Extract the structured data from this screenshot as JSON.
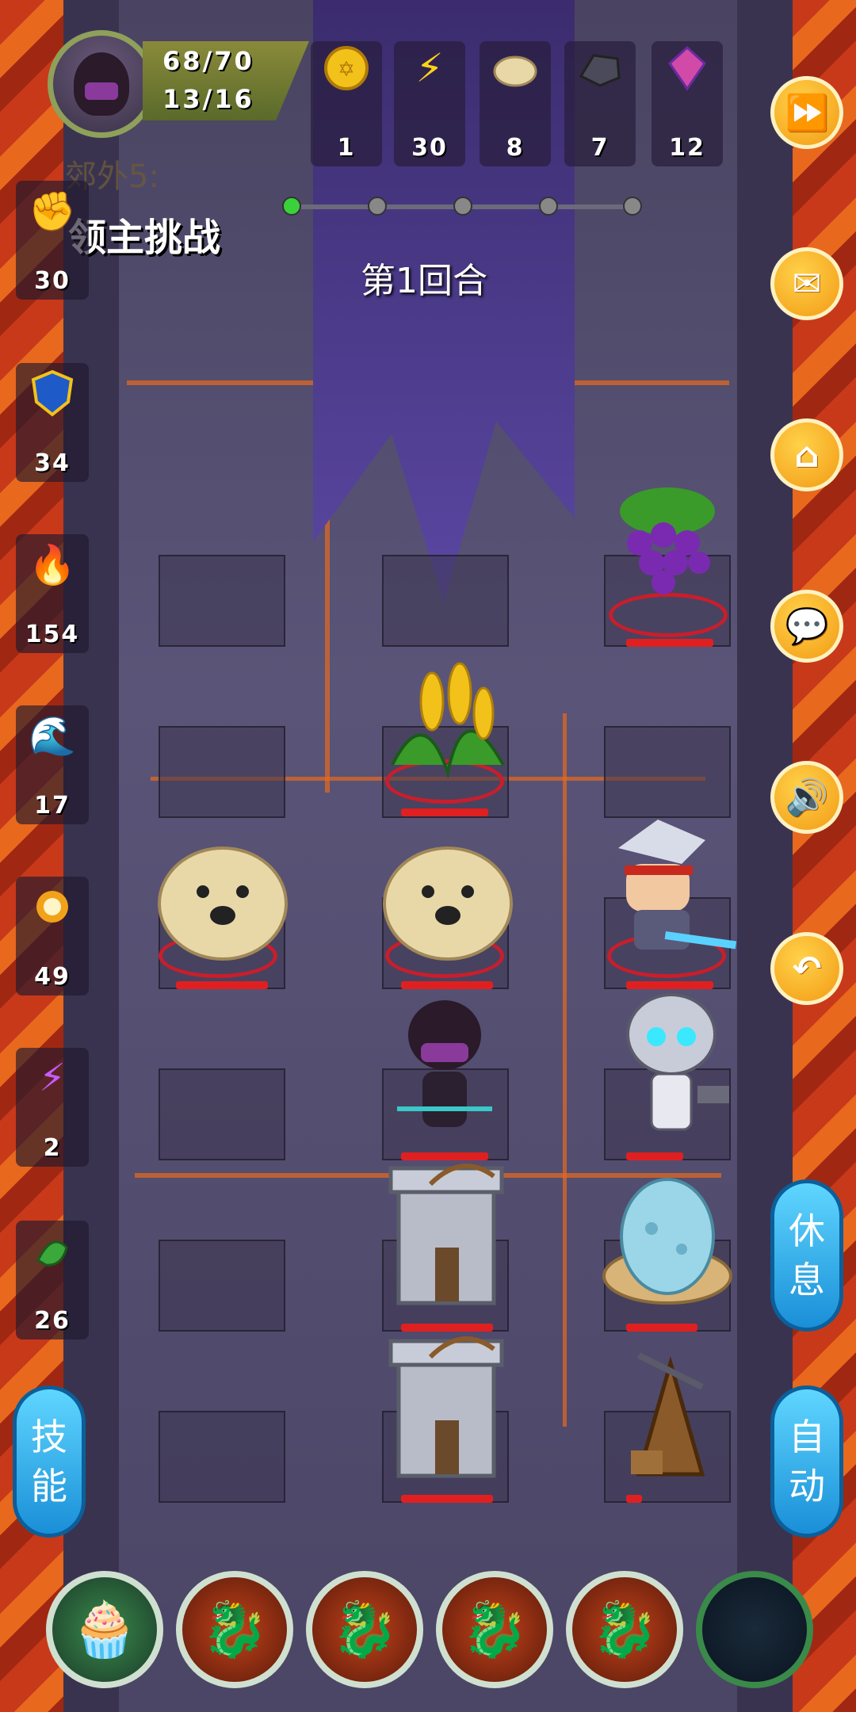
{
  "player": {
    "hp": "68/70",
    "level": "13/16"
  },
  "resources": [
    {
      "icon": "gold-coin-icon",
      "value": "1"
    },
    {
      "icon": "lightning-icon",
      "value": "30"
    },
    {
      "icon": "bun-icon",
      "value": "8"
    },
    {
      "icon": "iron-ore-icon",
      "value": "7"
    },
    {
      "icon": "crystal-icon",
      "value": "12"
    }
  ],
  "stage": {
    "label": "郊外5:",
    "challenge": "领主挑战",
    "round": "第1回合"
  },
  "left_stats": [
    {
      "icon": "fist-icon",
      "value": "30"
    },
    {
      "icon": "shield-icon",
      "value": "34"
    },
    {
      "icon": "fire-spirit-icon",
      "value": "154"
    },
    {
      "icon": "wave-icon",
      "value": "17"
    },
    {
      "icon": "flame-icon",
      "value": "49"
    },
    {
      "icon": "lightning-rune-icon",
      "value": "2"
    },
    {
      "icon": "poison-icon",
      "value": "26"
    }
  ],
  "right_buttons": [
    {
      "icon": "fast-forward-icon"
    },
    {
      "icon": "mail-icon"
    },
    {
      "icon": "home-icon"
    },
    {
      "icon": "chat-icon"
    },
    {
      "icon": "sound-icon"
    },
    {
      "icon": "back-icon"
    }
  ],
  "pills": {
    "skill": [
      "技",
      "能"
    ],
    "rest": [
      "休",
      "息"
    ],
    "auto": [
      "自",
      "动"
    ]
  },
  "board": [
    {
      "type": "grape-bush"
    },
    {
      "type": "corn-plant"
    },
    {
      "type": "chowchow"
    },
    {
      "type": "chowchow"
    },
    {
      "type": "swordsman"
    },
    {
      "type": "ninja-hero"
    },
    {
      "type": "skeleton"
    },
    {
      "type": "arrow-tower"
    },
    {
      "type": "egg"
    },
    {
      "type": "arrow-tower"
    },
    {
      "type": "catapult"
    }
  ],
  "bottom_slots": [
    {
      "icon": "cupcake-icon"
    },
    {
      "icon": "fire-dragon-icon"
    },
    {
      "icon": "fire-dragon-icon"
    },
    {
      "icon": "fire-dragon-icon"
    },
    {
      "icon": "fire-dragon-icon"
    },
    {
      "icon": "empty-slot-icon"
    }
  ]
}
